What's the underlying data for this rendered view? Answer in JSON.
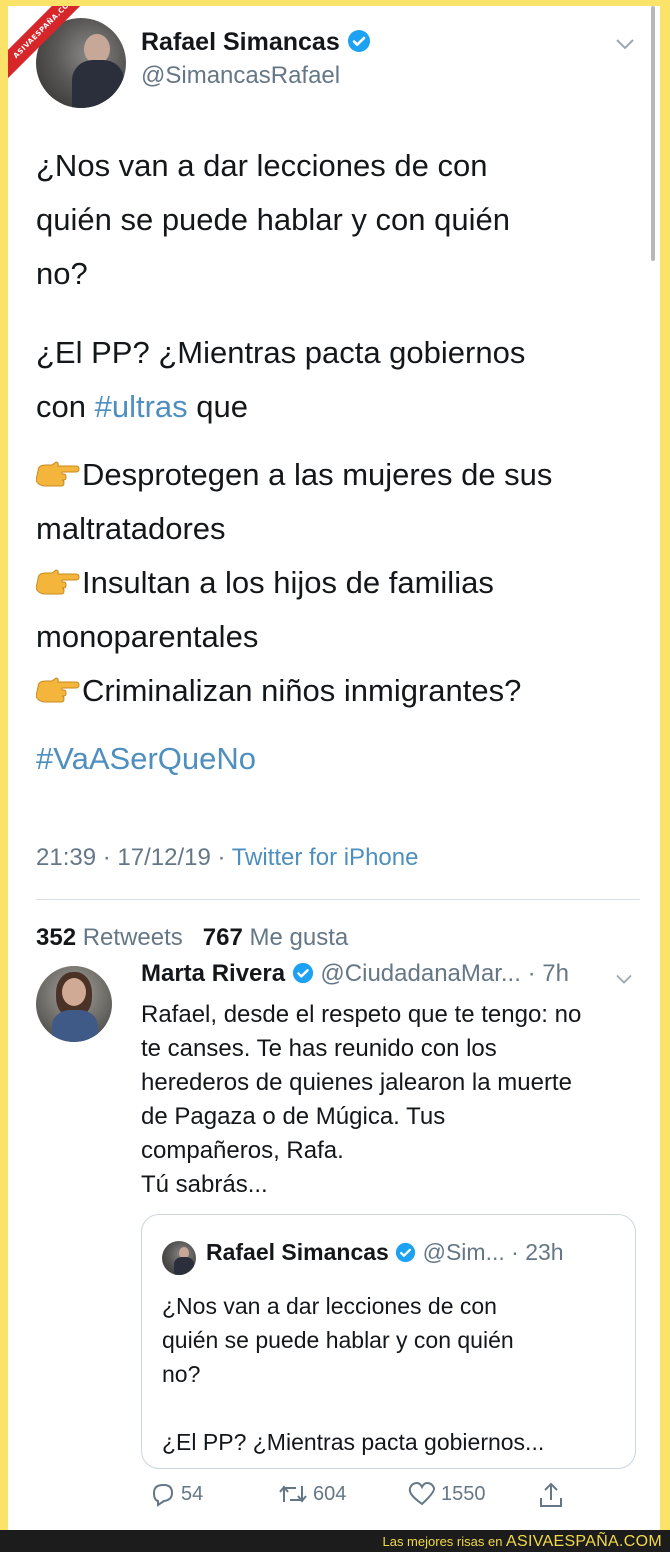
{
  "watermark": {
    "ribbon": "ASIVAESPAÑA.COM"
  },
  "tweet": {
    "author_name": "Rafael Simancas",
    "author_handle": "@SimancasRafael",
    "lines": [
      "¿Nos van a dar lecciones de con",
      "quién se puede hablar y con quién",
      "no?",
      "¿El PP? ¿Mientras pacta gobiernos",
      "con ",
      "#ultras",
      " que",
      "Desprotegen a las mujeres de sus",
      "maltratadores",
      "Insultan a los hijos de familias",
      "monoparentales",
      "Criminalizan niños inmigrantes?",
      "#VaASerQueNo"
    ],
    "time": "21:39 · 17/12/19 · ",
    "source": "Twitter for iPhone",
    "retweets_count": "352",
    "retweets_label": "Retweets",
    "likes_count": "767",
    "likes_label": "Me gusta"
  },
  "reply": {
    "author_name": "Marta Rivera",
    "author_handle": "@CiudadanaMar...",
    "time": "· 7h",
    "text_lines": [
      "Rafael, desde el respeto que te tengo: no",
      "te canses. Te has reunido con los",
      "herederos de quienes jalearon la muerte",
      "de Pagaza o de Múgica. Tus",
      "compañeros, Rafa.",
      "Tú sabrás..."
    ],
    "quoted": {
      "author_name": "Rafael Simancas",
      "author_handle": "@Sim...",
      "time": "· 23h",
      "text_lines": [
        "¿Nos van a dar lecciones de con",
        "quién se puede hablar y con quién",
        "no?",
        "",
        "¿El PP? ¿Mientras pacta gobiernos..."
      ]
    },
    "actions": {
      "replies": "54",
      "retweets": "604",
      "likes": "1550"
    }
  },
  "footer": {
    "text": "Las mejores risas en ",
    "brand": "ASIVAESPAÑA.COM"
  },
  "colors": {
    "border": "#fbe36a",
    "link": "#4e8fbf",
    "verified": "#1da1f2",
    "muted": "#657786"
  },
  "icons": [
    "verified-badge-icon",
    "chevron-down-icon",
    "pointing-hand-icon",
    "reply-icon",
    "retweet-icon",
    "like-icon",
    "share-icon"
  ]
}
